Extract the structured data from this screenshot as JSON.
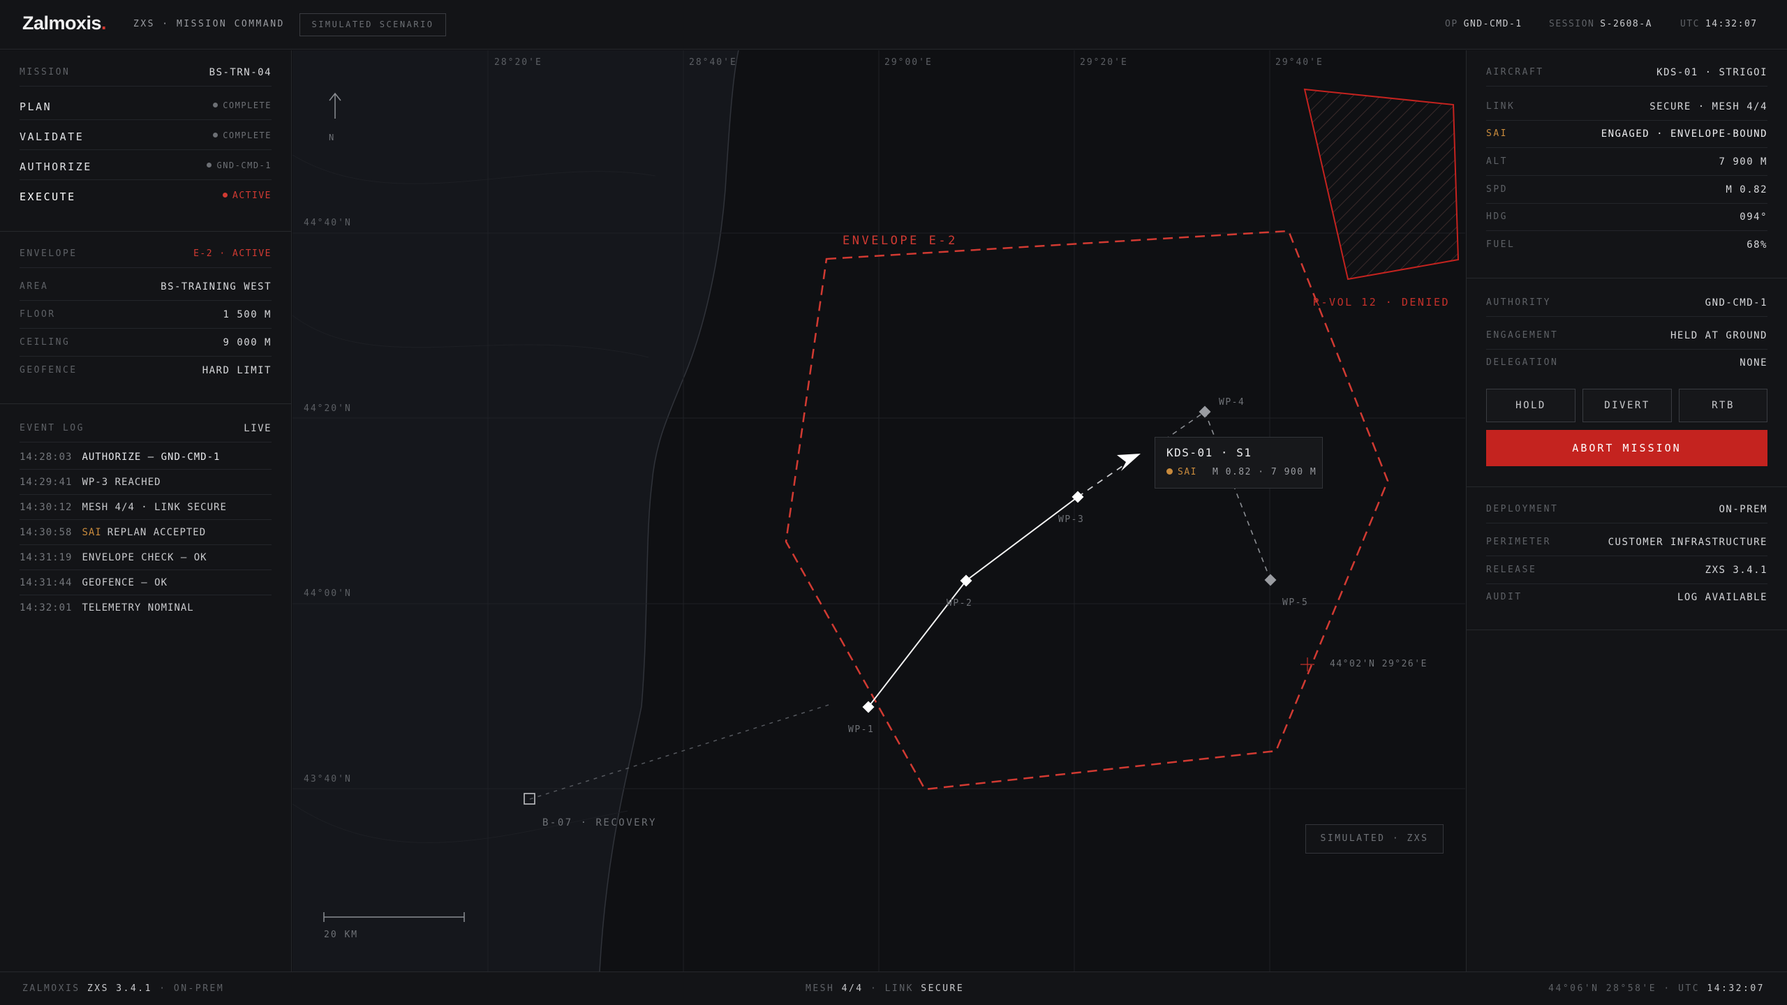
{
  "header": {
    "logo": "Zalmoxis",
    "logo_dot": ".",
    "subtitle": "ZXS · MISSION COMMAND",
    "sim_badge": "SIMULATED SCENARIO",
    "op_label": "OP",
    "op_value": "GND-CMD-1",
    "session_label": "SESSION",
    "session_value": "S-2608-A",
    "utc_label": "UTC",
    "utc_value": "14:32:07"
  },
  "mission": {
    "label": "MISSION",
    "value": "BS-TRN-04",
    "steps": [
      {
        "label": "PLAN",
        "status": "COMPLETE",
        "color": "#6d7075"
      },
      {
        "label": "VALIDATE",
        "status": "COMPLETE",
        "color": "#6d7075"
      },
      {
        "label": "AUTHORIZE",
        "status": "GND-CMD-1",
        "color": "#6d7075"
      },
      {
        "label": "EXECUTE",
        "status": "ACTIVE",
        "color": "#d13a32"
      }
    ]
  },
  "envelope": {
    "label": "ENVELOPE",
    "value": "E-2 · ACTIVE",
    "rows": [
      {
        "k": "AREA",
        "v": "BS-TRAINING WEST"
      },
      {
        "k": "FLOOR",
        "v": "1 500 M"
      },
      {
        "k": "CEILING",
        "v": "9 000 M"
      },
      {
        "k": "GEOFENCE",
        "v": "HARD LIMIT"
      }
    ]
  },
  "event_log": {
    "label": "EVENT LOG",
    "status": "LIVE",
    "entries": [
      {
        "t": "14:28:03",
        "m": "AUTHORIZE — GND-CMD-1"
      },
      {
        "t": "14:29:41",
        "m": "WP-3 REACHED"
      },
      {
        "t": "14:30:12",
        "m": "MESH 4/4 · LINK SECURE"
      },
      {
        "t": "14:30:58",
        "sai": "SAI",
        "m": "REPLAN ACCEPTED"
      },
      {
        "t": "14:31:19",
        "m": "ENVELOPE CHECK — OK"
      },
      {
        "t": "14:31:44",
        "m": "GEOFENCE — OK"
      },
      {
        "t": "14:32:01",
        "m": "TELEMETRY NOMINAL"
      }
    ]
  },
  "aircraft": {
    "rows": [
      {
        "k": "AIRCRAFT",
        "v": "KDS-01 · STRIGOI"
      },
      {
        "k": "LINK",
        "v": "SECURE · MESH 4/4"
      },
      {
        "k": "SAI",
        "v": "ENGAGED · ENVELOPE-BOUND"
      },
      {
        "k": "ALT",
        "v": "7 900 M"
      },
      {
        "k": "SPD",
        "v": "M 0.82"
      },
      {
        "k": "HDG",
        "v": "094°"
      },
      {
        "k": "FUEL",
        "v": "68%"
      }
    ]
  },
  "authority": {
    "rows": [
      {
        "k": "AUTHORITY",
        "v": "GND-CMD-1"
      },
      {
        "k": "ENGAGEMENT",
        "v": "HELD AT GROUND"
      },
      {
        "k": "DELEGATION",
        "v": "NONE"
      }
    ],
    "buttons": [
      "HOLD",
      "DIVERT",
      "RTB"
    ],
    "abort": "ABORT MISSION"
  },
  "deployment": {
    "rows": [
      {
        "k": "DEPLOYMENT",
        "v": "ON-PREM"
      },
      {
        "k": "PERIMETER",
        "v": "CUSTOMER INFRASTRUCTURE"
      },
      {
        "k": "RELEASE",
        "v": "ZXS 3.4.1"
      },
      {
        "k": "AUDIT",
        "v": "LOG AVAILABLE"
      }
    ]
  },
  "map": {
    "lon_labels": [
      "28°20'E",
      "28°40'E",
      "29°00'E",
      "29°20'E",
      "29°40'E"
    ],
    "lat_labels": [
      "44°40'N",
      "44°20'N",
      "44°00'N",
      "43°40'N"
    ],
    "north": "N",
    "envelope_label": "ENVELOPE E-2",
    "rvol_label": "R-VOL 12 · DENIED",
    "waypoints": [
      "WP-1",
      "WP-2",
      "WP-3",
      "WP-4",
      "WP-5"
    ],
    "recovery": "B-07 · RECOVERY",
    "cursor_coord": "44°02'N 29°26'E",
    "scale": "20 KM",
    "sim_box": "SIMULATED · ZXS",
    "tooltip": {
      "title": "KDS-01 · S1",
      "sai": "SAI",
      "detail": "M 0.82 · 7 900 M"
    },
    "colors": {
      "envelope": "#d13a32",
      "path": "#f2f2f2",
      "sai": "#c88a3c"
    }
  },
  "footer": {
    "brand": "ZALMOXIS",
    "version": "ZXS 3.4.1",
    "deploy": "ON-PREM",
    "mesh_label": "MESH",
    "mesh_value": "4/4",
    "link_label": "LINK",
    "link_value": "SECURE",
    "coord": "44°06'N 28°58'E",
    "utc_label": "UTC",
    "utc_value": "14:32:07"
  }
}
